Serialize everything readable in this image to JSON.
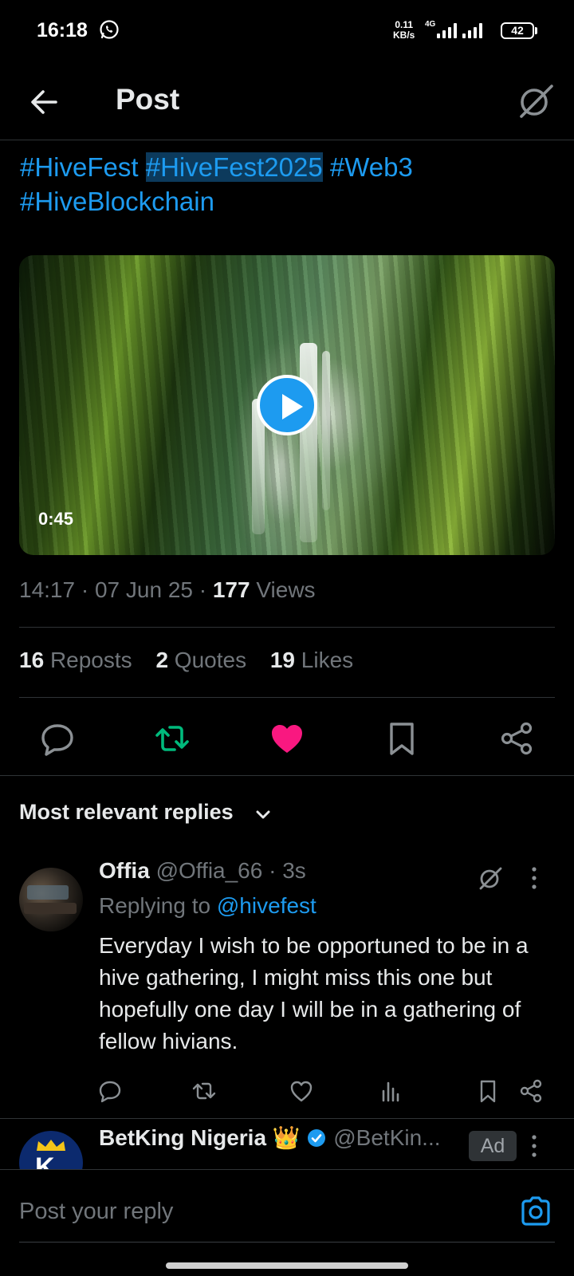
{
  "status_bar": {
    "time": "16:18",
    "net_speed_value": "0.11",
    "net_speed_unit": "KB/s",
    "network": "4G",
    "battery": "42"
  },
  "header": {
    "title": "Post"
  },
  "post": {
    "hashtags": [
      "#HiveFest",
      "#HiveFest2025",
      "#Web3",
      "#HiveBlockchain"
    ],
    "video": {
      "duration": "0:45"
    },
    "time": "14:17",
    "date": "07 Jun 25",
    "views_count": "177",
    "views_label": "Views",
    "reposts_count": "16",
    "reposts_label": "Reposts",
    "quotes_count": "2",
    "quotes_label": "Quotes",
    "likes_count": "19",
    "likes_label": "Likes"
  },
  "replies": {
    "sort_label": "Most relevant replies",
    "items": [
      {
        "name": "Offia",
        "handle": "@Offia_66",
        "time": "3s",
        "replying_label": "Replying to",
        "replying_handle": "@hivefest",
        "text": "Everyday I wish to be opportuned to be in a hive gathering, I might miss this one but hopefully one day I will be in a gathering of fellow hivians."
      }
    ],
    "ad": {
      "name": "BetKing Nigeria",
      "emoji": "👑",
      "handle": "@BetKin...",
      "badge": "Ad"
    }
  },
  "compose": {
    "placeholder": "Post your reply"
  },
  "colors": {
    "accent": "#1d9bf0",
    "repost_active": "#00ba7c",
    "like_active": "#f91880",
    "muted": "#71767b"
  }
}
